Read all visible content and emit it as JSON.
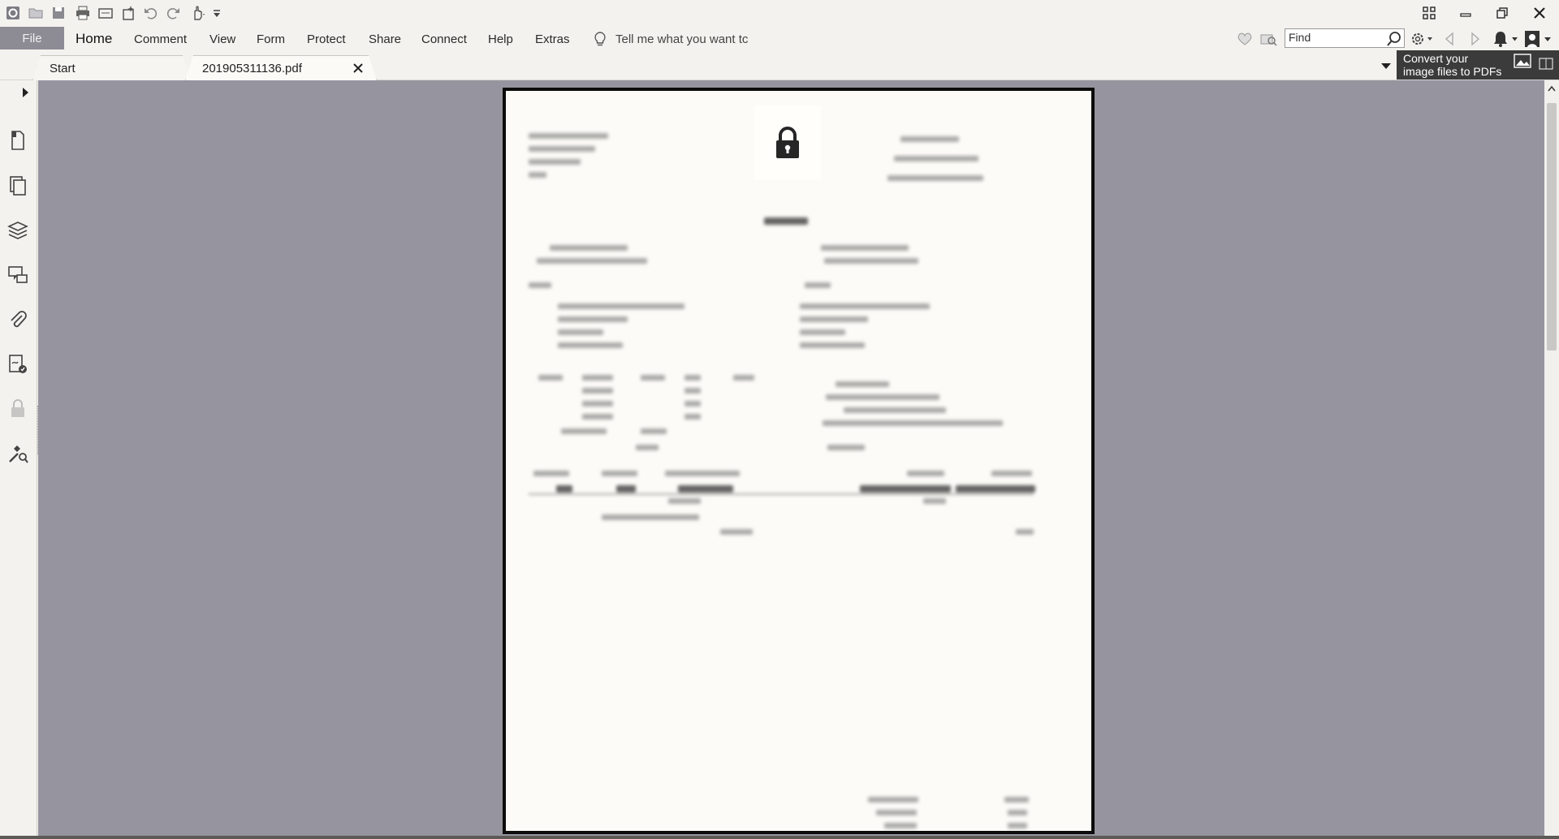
{
  "ribbon": {
    "file_label": "File",
    "tabs": [
      {
        "label": "Home",
        "active": true
      },
      {
        "label": "Comment"
      },
      {
        "label": "View"
      },
      {
        "label": "Form"
      },
      {
        "label": "Protect"
      },
      {
        "label": "Share"
      },
      {
        "label": "Connect"
      },
      {
        "label": "Help"
      },
      {
        "label": "Extras"
      }
    ],
    "tell_me_placeholder": "Tell me what you want tc",
    "find_placeholder": "Find"
  },
  "doc_tabs": {
    "start_label": "Start",
    "file_label": "201905311136.pdf"
  },
  "tooltip": {
    "line1": "Convert your",
    "line2": "image files to PDFs"
  },
  "colors": {
    "doc_background": "#96959f",
    "file_tab": "#8d8c95",
    "chrome": "#f4f2ee"
  },
  "icons": {
    "qat": [
      "app-logo-icon",
      "open-icon",
      "save-icon",
      "print-icon",
      "scan-icon",
      "new-icon",
      "undo-icon",
      "redo-icon",
      "hand-tool-icon",
      "customize-icon"
    ],
    "nav": [
      "page-thumbnails-icon",
      "pages-icon",
      "layers-icon",
      "comments-icon",
      "attachments-icon",
      "signatures-icon",
      "security-icon",
      "tools-icon"
    ]
  }
}
